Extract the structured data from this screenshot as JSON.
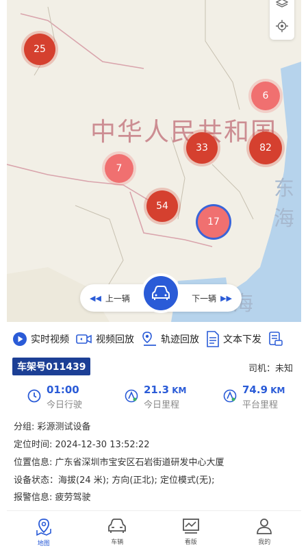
{
  "map": {
    "country_label": "中华人民共和国",
    "east_label": "东海",
    "sea_label": "海",
    "clusters": [
      {
        "count": "25",
        "style": "red"
      },
      {
        "count": "6",
        "style": "pink"
      },
      {
        "count": "33",
        "style": "red"
      },
      {
        "count": "82",
        "style": "red"
      },
      {
        "count": "7",
        "style": "pink"
      },
      {
        "count": "54",
        "style": "red"
      },
      {
        "count": "17",
        "style": "blue"
      }
    ]
  },
  "nav": {
    "prev_label": "上一辆",
    "next_label": "下一辆"
  },
  "actions": [
    {
      "label": "实时视频",
      "icon": "play-icon"
    },
    {
      "label": "视频回放",
      "icon": "video-playback-icon"
    },
    {
      "label": "轨迹回放",
      "icon": "track-icon"
    },
    {
      "label": "文本下发",
      "icon": "document-icon"
    },
    {
      "label": "",
      "icon": "vehicle-list-icon"
    }
  ],
  "vehicle": {
    "vin_label": "车架号011439",
    "driver": "司机：未知",
    "stats": [
      {
        "value": "01:00",
        "unit": "",
        "label": "今日行驶",
        "icon": "clock-icon"
      },
      {
        "value": "21.3",
        "unit": " KM",
        "label": "今日里程",
        "icon": "odometer-icon"
      },
      {
        "value": "74.9",
        "unit": " KM",
        "label": "平台里程",
        "icon": "odometer-icon"
      }
    ],
    "group": "分组: 彩源测试设备",
    "location_time": "定位时间: 2024-12-30 13:52:22",
    "address": "位置信息: 广东省深圳市宝安区石岩街道研发中心大厦",
    "device_status": "设备状态：海拔(24 米); 方向(正北); 定位模式(无);",
    "alarm": "报警信息: 疲劳驾驶"
  },
  "tabbar": [
    {
      "label": "地图",
      "icon": "map-pin-icon",
      "active": true
    },
    {
      "label": "车辆",
      "icon": "car-icon",
      "active": false
    },
    {
      "label": "看版",
      "icon": "chart-board-icon",
      "active": false
    },
    {
      "label": "我的",
      "icon": "user-icon",
      "active": false
    }
  ],
  "colors": {
    "accent": "#2a5bd7",
    "badge": "#1c3f95",
    "cluster_red": "#d5402f",
    "cluster_pink": "#f07070"
  }
}
